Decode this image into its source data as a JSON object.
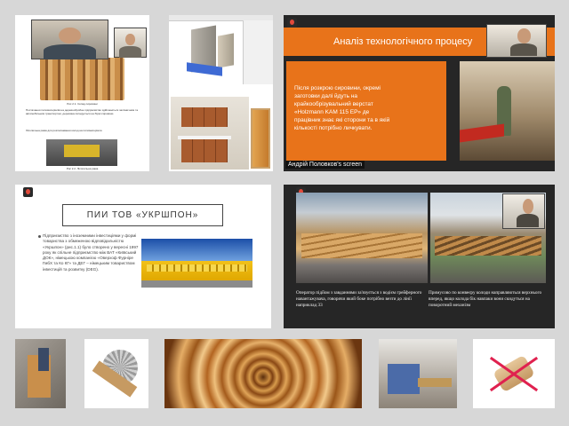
{
  "tiles": {
    "t1": {
      "figure_caption": "Рис 2.1. Склад сировини",
      "paragraph_1": "Постачання пиломатеріалів на деревообробне підприємство здійснюється залізничним та автомобільним транспортом, деревина складується на біржі сировини.",
      "paragraph_2": "Лісопильна рама для розпилювання колод на пиломатеріали.",
      "figure_caption_2": "Рис 2.2. Лісопильна рама"
    },
    "t3": {
      "title": "Аналіз технологічного процесу",
      "body": "Після розкрою сировини, окремі заготовки далі йдуть на крайкообрізувальний верстат «Holzmann KAM 115 EP» де працівник знає які сторони та в якій кількості потрібно личкувати.",
      "screen_label": "Андрій Половков's screen"
    },
    "t4": {
      "title": "ПИИ ТОВ «УКРШПОН»",
      "body": "Підприємство з іноземними інвестиціями у формі товариства з обмеженою відповідальністю «Укршпон» (рис.1.1) було створено у вересні 1997 року як спільне підприємство між ВАТ «Київський ДОК», німецькою компанією «Оверхоф Фурніре ГмбХ та Ко КГ» та ДЕГ – німецьким товариством інвестицій та розвитку (DEG)."
    },
    "t5": {
      "caption_left": "Оператор підйом з завданнями за'язується з водієм грейферного навантажувача, говорячи який боке потрібно везти до лінії наприклад 33",
      "caption_right": "Примусово по конвеєру колоди направляються верхнього вперед, якщо колода бік навпаки вони скидуться на поворотний механізм"
    }
  },
  "colors": {
    "background": "#d7d7d7",
    "accent_orange": "#e8731a",
    "dark_slide": "#262626",
    "slide_white": "#ffffff"
  }
}
